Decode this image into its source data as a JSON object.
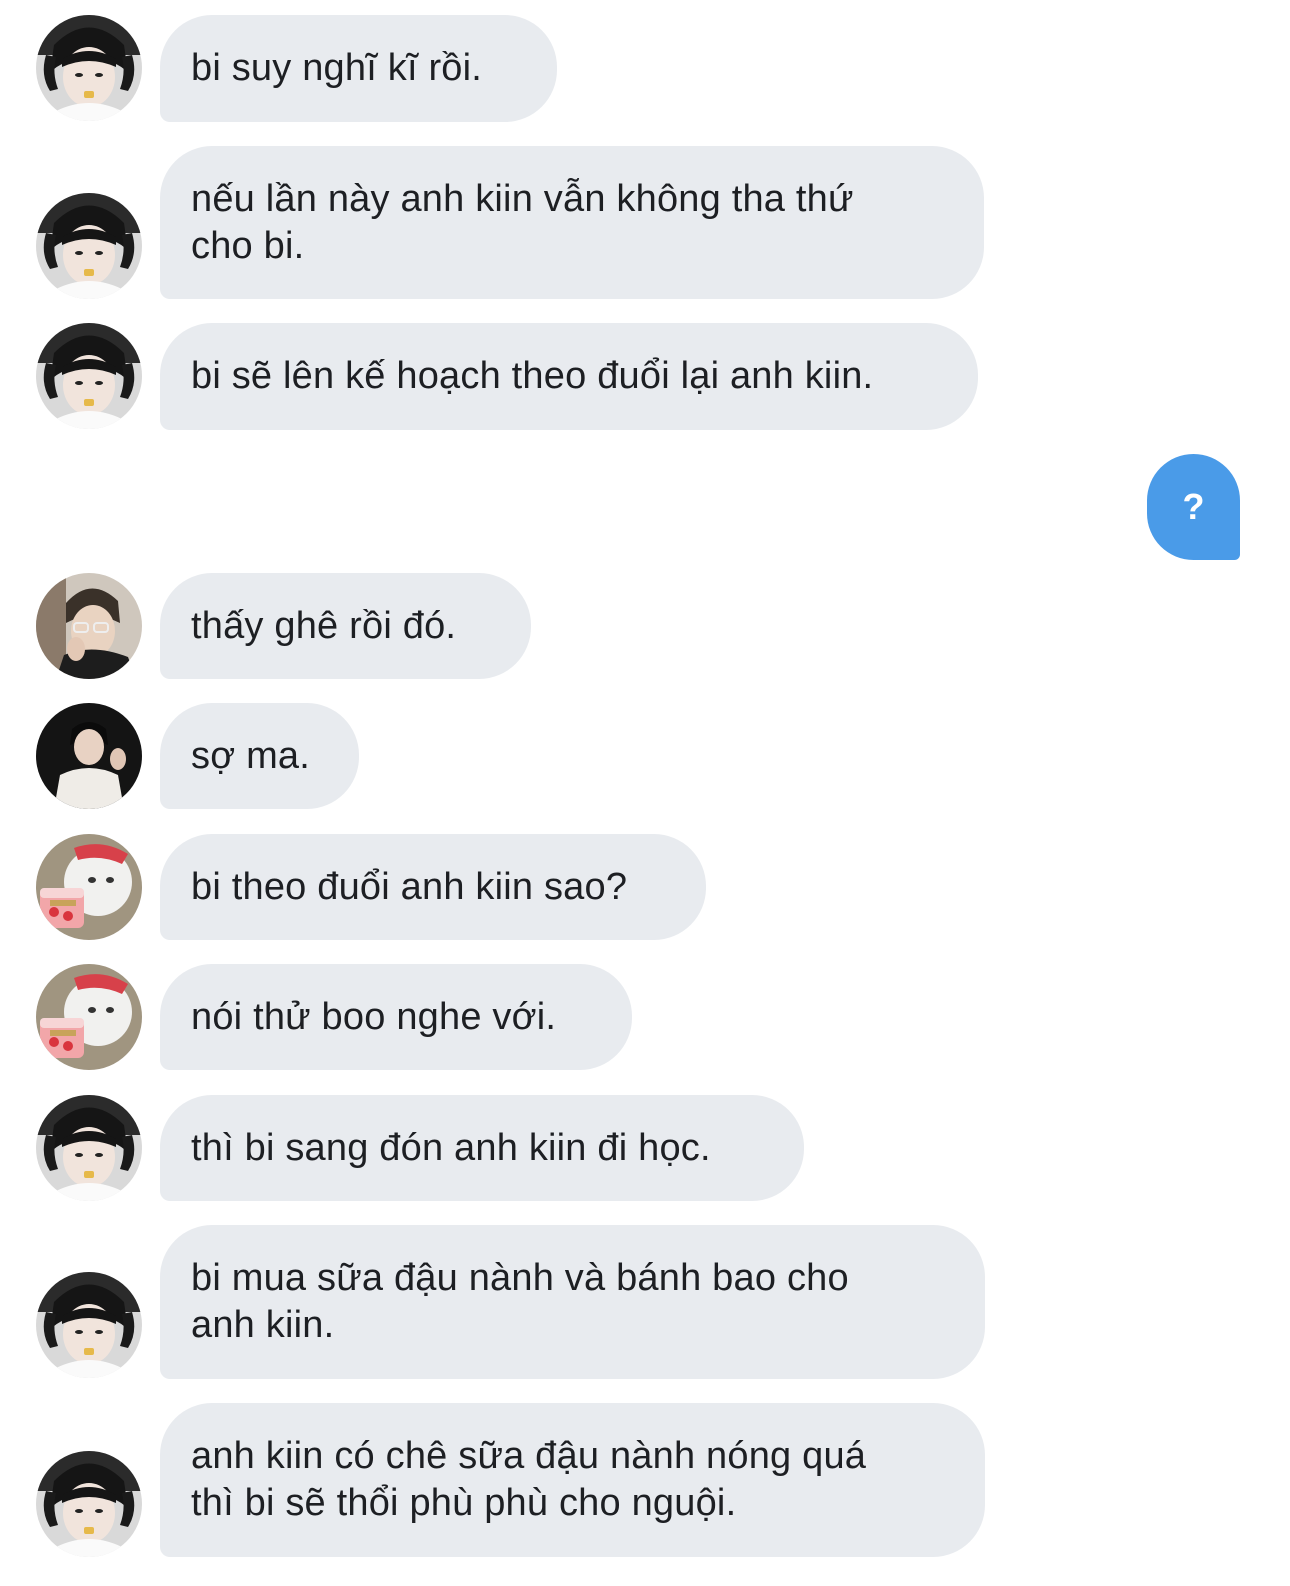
{
  "messages": [
    {
      "sender": "bi",
      "text": "bi suy nghĩ kĩ rồi."
    },
    {
      "sender": "bi",
      "text": "nếu lần này anh kiin vẫn không tha thứ\ncho bi."
    },
    {
      "sender": "bi",
      "text": "bi sẽ lên kế hoạch theo đuổi lại anh kiin."
    },
    {
      "sender": "me",
      "text": "?"
    },
    {
      "sender": "guy-glasses",
      "text": "thấy ghê rồi đó."
    },
    {
      "sender": "guy-dark",
      "text": "sợ ma."
    },
    {
      "sender": "boo",
      "text": "bi theo đuổi anh kiin sao?"
    },
    {
      "sender": "boo",
      "text": "nói thử boo nghe với."
    },
    {
      "sender": "bi",
      "text": "thì bi sang đón anh kiin đi học."
    },
    {
      "sender": "bi",
      "text": "bi mua sữa đậu nành và bánh bao cho\nanh kiin."
    },
    {
      "sender": "bi",
      "text": "anh kiin có chê sữa đậu nành nóng quá\nthì bi sẽ thổi phù phù cho nguội."
    }
  ],
  "colors": {
    "incoming_bubble": "#e8ebef",
    "outgoing_bubble": "#4a9be8",
    "text": "#1d1f23"
  }
}
